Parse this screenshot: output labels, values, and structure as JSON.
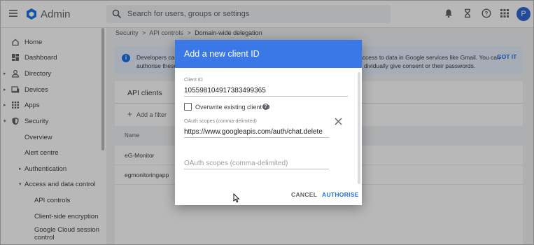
{
  "app": {
    "title": "Admin"
  },
  "search": {
    "placeholder": "Search for users, groups or settings"
  },
  "topbar_icons": [
    "notifications-icon",
    "hourglass-icon",
    "help-icon",
    "apps-icon"
  ],
  "user": {
    "avatar_initial": "P",
    "avatar_color": "#3367d6"
  },
  "sidebar": {
    "items": [
      {
        "label": "Home",
        "icon": "home-icon",
        "caret": ""
      },
      {
        "label": "Dashboard",
        "icon": "dashboard-icon",
        "caret": ""
      },
      {
        "label": "Directory",
        "icon": "person-icon",
        "caret": "▸"
      },
      {
        "label": "Devices",
        "icon": "devices-icon",
        "caret": "▸"
      },
      {
        "label": "Apps",
        "icon": "apps-grid-icon",
        "caret": "▸"
      },
      {
        "label": "Security",
        "icon": "shield-icon",
        "caret": "▾"
      },
      {
        "label": "Overview",
        "icon": "",
        "caret": ""
      },
      {
        "label": "Alert centre",
        "icon": "",
        "caret": ""
      },
      {
        "label": "Authentication",
        "icon": "",
        "caret": "▸"
      },
      {
        "label": "Access and data control",
        "icon": "",
        "caret": "▾"
      },
      {
        "label": "API controls",
        "icon": "",
        "caret": ""
      },
      {
        "label": "Client-side encryption",
        "icon": "",
        "caret": ""
      },
      {
        "label": "Google Cloud session",
        "label2": "control",
        "icon": "",
        "caret": ""
      }
    ]
  },
  "breadcrumb": {
    "items": [
      "Security",
      "API controls"
    ],
    "current": "Domain-wide delegation",
    "separator": ">"
  },
  "banner": {
    "text_left_1": "Developers can",
    "text_left_2": "authorise these",
    "text_right_1": "access to data in Google services like Gmail. You can",
    "text_right_2": "dividually give consent or their passwords.",
    "action": "GOT IT"
  },
  "clients_card": {
    "title": "API clients",
    "add_filter": "Add a filter",
    "column_name": "Name",
    "rows": [
      "eG-Monitor",
      "egmonitoringapp"
    ]
  },
  "dialog": {
    "title": "Add a new client ID",
    "client_id_label": "Client ID",
    "client_id_value": "105598104917383499365",
    "overwrite_label": "Overwrite existing client ID",
    "overwrite_checked": false,
    "scopes_label": "OAuth scopes (comma-delimited)",
    "scopes_value": "https://www.googleapis.com/auth/chat.delete",
    "scopes_placeholder": "OAuth scopes (comma-delimited)",
    "cancel_label": "CANCEL",
    "authorise_label": "AUTHORISE",
    "header_color": "#3b78e7"
  }
}
